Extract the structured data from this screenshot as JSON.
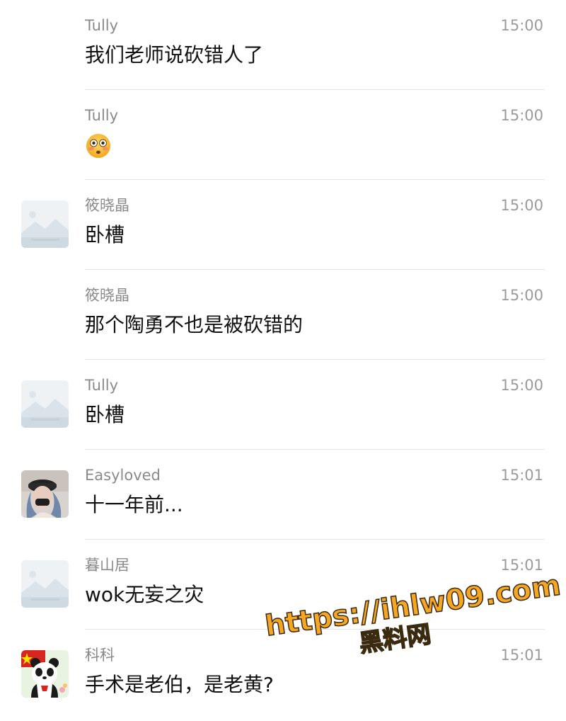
{
  "messages": [
    {
      "sender": "Tully",
      "time": "15:00",
      "text": "我们老师说砍错人了",
      "avatar": "none"
    },
    {
      "sender": "Tully",
      "time": "15:00",
      "text": "",
      "emoji": "flushed-face-emoji",
      "avatar": "none"
    },
    {
      "sender": "筱晓晶",
      "time": "15:00",
      "text": "卧槽",
      "avatar": "placeholder-image-icon"
    },
    {
      "sender": "筱晓晶",
      "time": "15:00",
      "text": "那个陶勇不也是被砍错的",
      "avatar": "none"
    },
    {
      "sender": "Tully",
      "time": "15:00",
      "text": "卧槽",
      "avatar": "placeholder-image-icon"
    },
    {
      "sender": "Easyloved",
      "time": "15:01",
      "text": "十一年前...",
      "avatar": "photo-avatar"
    },
    {
      "sender": "暮山居",
      "time": "15:01",
      "text": "wok无妄之灾",
      "avatar": "placeholder-image-icon"
    },
    {
      "sender": "科科",
      "time": "15:01",
      "text": "手术是老伯，是老黄?",
      "avatar": "panda-avatar"
    }
  ],
  "watermark": {
    "url": "https://ihlw09.com",
    "name": "黑料网"
  },
  "colors": {
    "sender": "#8a8a8a",
    "time": "#9b9b9b",
    "text": "#111111",
    "divider": "#e5e5e5",
    "watermark": "#f5a623"
  }
}
